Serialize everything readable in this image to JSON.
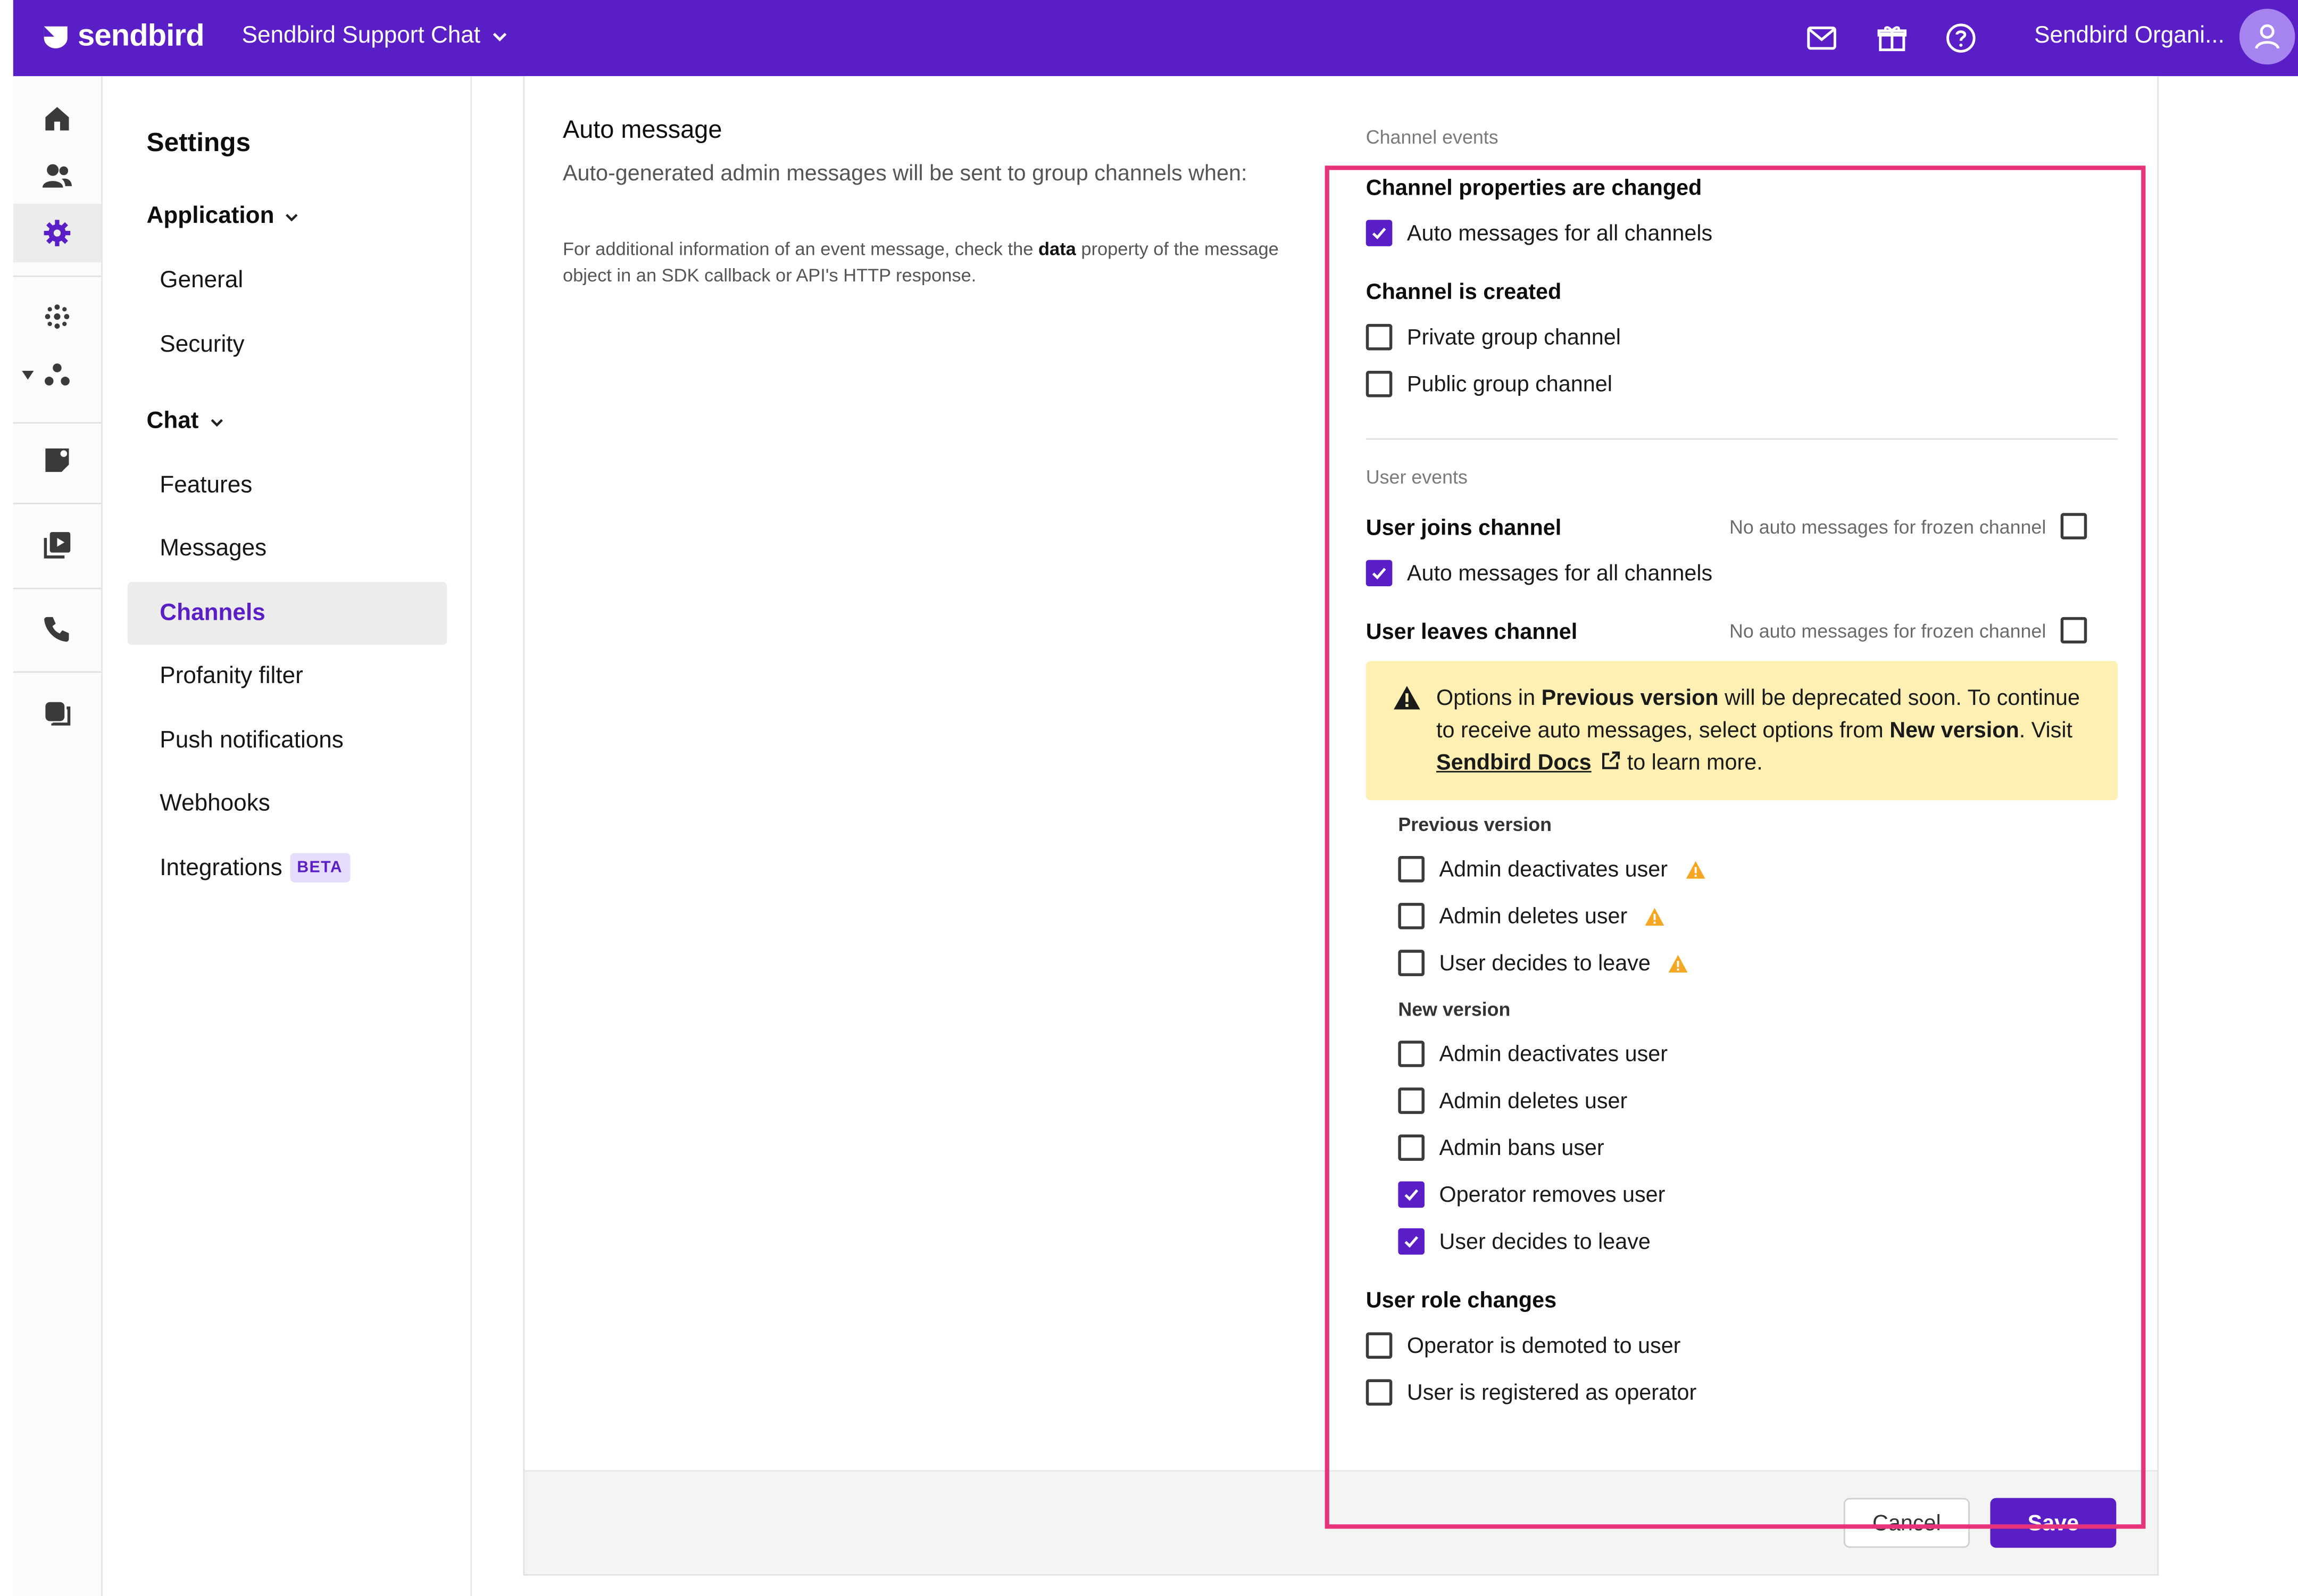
{
  "header": {
    "logo_text": "sendbird",
    "app_name": "Sendbird Support Chat",
    "org_name": "Sendbird Organi..."
  },
  "settings_nav": {
    "title": "Settings",
    "groups": [
      {
        "label": "Application",
        "items": [
          "General",
          "Security"
        ]
      },
      {
        "label": "Chat",
        "items": [
          "Features",
          "Messages",
          "Channels",
          "Profanity filter",
          "Push notifications",
          "Webhooks",
          "Integrations"
        ]
      }
    ],
    "active_item": "Channels",
    "integrations_badge": "BETA"
  },
  "auto_message": {
    "title": "Auto message",
    "description": "Auto-generated admin messages will be sent to group channels when:",
    "note_prefix": "For additional information of an event message, check the ",
    "note_bold": "data",
    "note_suffix": " property of the message object in an SDK callback or API's HTTP response."
  },
  "channel_events": {
    "label": "Channel events",
    "properties_changed": {
      "title": "Channel properties are changed",
      "options": [
        {
          "label": "Auto messages for all channels",
          "checked": true
        }
      ]
    },
    "channel_created": {
      "title": "Channel is created",
      "options": [
        {
          "label": "Private group channel",
          "checked": false
        },
        {
          "label": "Public group channel",
          "checked": false
        }
      ]
    }
  },
  "user_events": {
    "label": "User events",
    "joins": {
      "title": "User joins channel",
      "frozen_label": "No auto messages for frozen channel",
      "frozen_checked": false,
      "options": [
        {
          "label": "Auto messages for all channels",
          "checked": true
        }
      ]
    },
    "leaves": {
      "title": "User leaves channel",
      "frozen_label": "No auto messages for frozen channel",
      "frozen_checked": false,
      "alert": {
        "t1": "Options in ",
        "b1": "Previous version",
        "t2": " will be deprecated soon. To continue to receive auto messages, select options from ",
        "b2": "New version",
        "t3": ". Visit ",
        "link": "Sendbird Docs",
        "t4": " to learn more."
      },
      "previous_version": {
        "label": "Previous version",
        "options": [
          {
            "label": "Admin deactivates user",
            "checked": false
          },
          {
            "label": "Admin deletes user",
            "checked": false
          },
          {
            "label": "User decides to leave",
            "checked": false
          }
        ]
      },
      "new_version": {
        "label": "New version",
        "options": [
          {
            "label": "Admin deactivates user",
            "checked": false
          },
          {
            "label": "Admin deletes user",
            "checked": false
          },
          {
            "label": "Admin bans user",
            "checked": false
          },
          {
            "label": "Operator removes user",
            "checked": true
          },
          {
            "label": "User decides to leave",
            "checked": true
          }
        ]
      }
    },
    "role_changes": {
      "title": "User role changes",
      "options": [
        {
          "label": "Operator is demoted to user",
          "checked": false
        },
        {
          "label": "User is registered as operator",
          "checked": false
        }
      ]
    }
  },
  "footer": {
    "cancel": "Cancel",
    "save": "Save"
  },
  "colors": {
    "brand": "#5a1ec6",
    "highlight": "#e6337a",
    "alert_bg": "#fdf0b2",
    "warning": "#f5a623"
  },
  "icons": [
    "mail-icon",
    "gift-icon",
    "help-icon",
    "user-icon",
    "home-icon",
    "users-icon",
    "gear-icon",
    "warning-icon",
    "external-link-icon",
    "check-icon"
  ]
}
